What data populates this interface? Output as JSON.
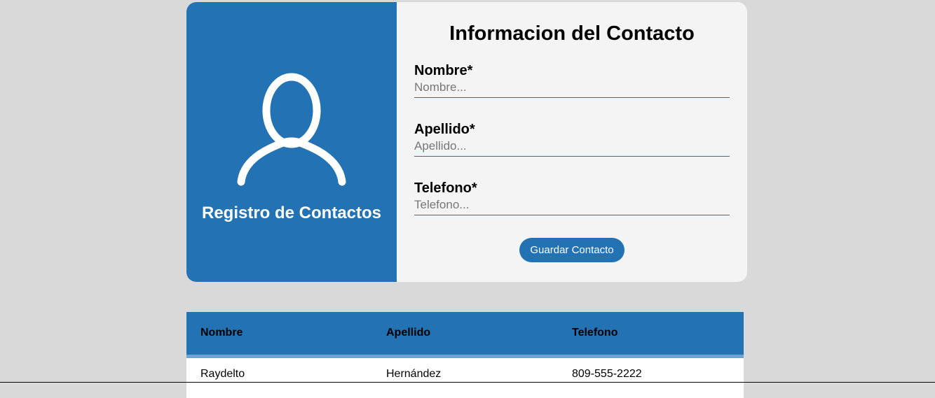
{
  "brand": {
    "title": "Registro de Contactos",
    "icon": "user-icon"
  },
  "form": {
    "title": "Informacion del Contacto",
    "fields": [
      {
        "label": "Nombre*",
        "placeholder": "Nombre...",
        "value": ""
      },
      {
        "label": "Apellido*",
        "placeholder": "Apellido...",
        "value": ""
      },
      {
        "label": "Telefono*",
        "placeholder": "Telefono...",
        "value": ""
      }
    ],
    "submit_label": "Guardar Contacto"
  },
  "table": {
    "headers": [
      "Nombre",
      "Apellido",
      "Telefono"
    ],
    "rows": [
      [
        "Raydelto",
        "Hernández",
        "809-555-2222"
      ]
    ]
  },
  "colors": {
    "accent": "#2372b4",
    "background": "#d9d9d9",
    "form_background": "#f4f4f4",
    "header_border": "#6ea3d2"
  }
}
